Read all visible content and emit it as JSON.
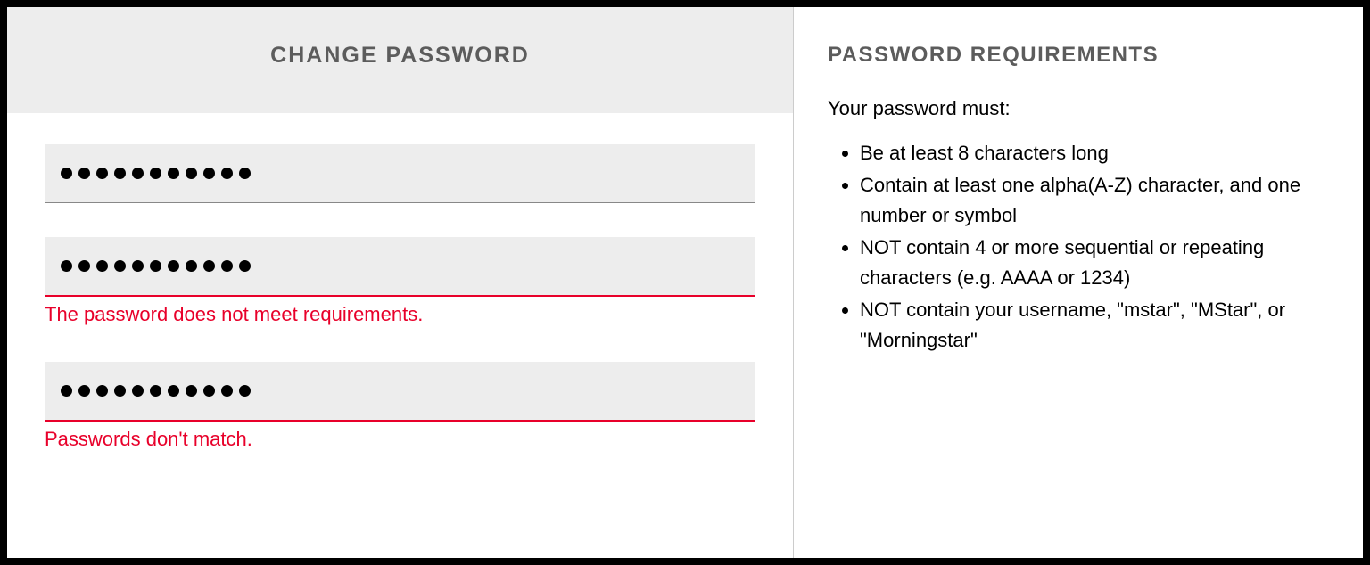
{
  "left": {
    "title": "CHANGE PASSWORD",
    "fields": {
      "current": {
        "dot_count": 11
      },
      "new": {
        "dot_count": 11,
        "error": "The password does not meet requirements."
      },
      "confirm": {
        "dot_count": 11,
        "error": "Passwords don't match."
      }
    }
  },
  "right": {
    "title": "PASSWORD REQUIREMENTS",
    "intro": "Your password must:",
    "items": [
      "Be at least 8 characters long",
      "Contain at least one alpha(A-Z) character, and one number or symbol",
      "NOT contain 4 or more sequential or repeating characters (e.g. AAAA or 1234)",
      "NOT contain your username, \"mstar\", \"MStar\", or \"Morningstar\""
    ]
  },
  "colors": {
    "error": "#e8002a",
    "muted": "#5c5c5c",
    "input_bg": "#ededed"
  }
}
